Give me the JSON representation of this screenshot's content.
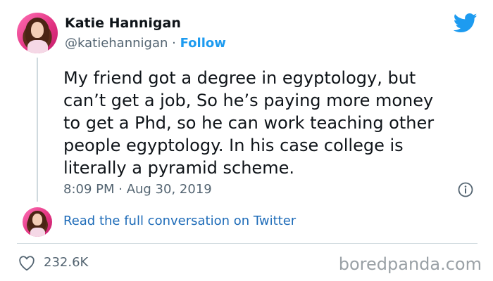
{
  "author": {
    "name": "Katie Hannigan",
    "handle": "@katiehannigan",
    "separator": "·",
    "follow_label": "Follow"
  },
  "tweet": {
    "text": "My friend got a degree in egyptology, but\ncan’t get a job, So he’s paying more money\nto get a Phd, so he can work teaching other\npeople egyptology.  In his case college is\nliterally a pyramid scheme.",
    "timestamp": "8:09 PM · Aug 30, 2019"
  },
  "conversation_link": "Read the full conversation on Twitter",
  "likes": "232.6K",
  "watermark": "boredpanda.com",
  "icons": {
    "brand": "twitter-bird-icon",
    "info": "info-icon",
    "like": "heart-icon"
  },
  "colors": {
    "accent": "#1d9bf0",
    "link": "#1d6bb8",
    "muted": "#536471",
    "text": "#0f1419",
    "divider": "#cfd9de"
  }
}
